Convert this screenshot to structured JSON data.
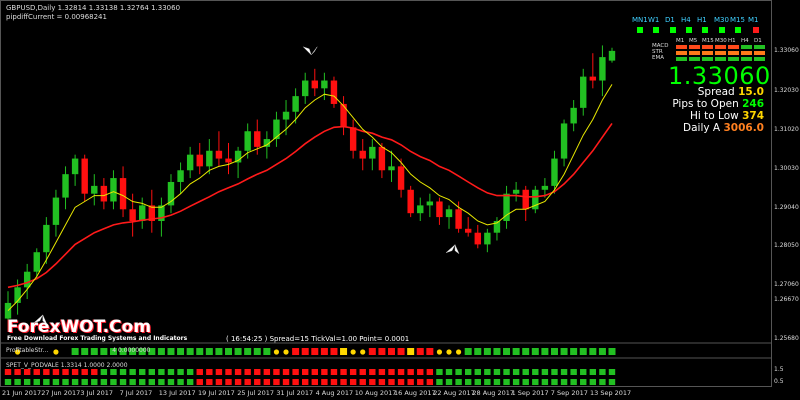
{
  "header": {
    "symbol_line": "GBPUSD,Daily   1.32814 1.33138 1.32764 1.33060",
    "pip_line": "pipdiffCurrent = 0.00968241"
  },
  "price_panel": {
    "price": "1.33060",
    "spread_label": "Spread",
    "spread_value": "15.0",
    "pips_open_label": "Pips to Open",
    "pips_open_value": "246",
    "hi_low_label": "Hi to Low",
    "hi_low_value": "374",
    "daily_label": "Daily A",
    "daily_value": "3006.0"
  },
  "timeframes": [
    "MN1",
    "W1",
    "D1",
    "H4",
    "H1",
    "M30",
    "M15",
    "M1"
  ],
  "matrix": {
    "cols": [
      "M1",
      "M5",
      "M15",
      "M30",
      "H1",
      "H4",
      "D1"
    ],
    "rows": [
      "MACD",
      "STR",
      "EMA"
    ]
  },
  "watermark": {
    "logo": "ForexWOT.Com",
    "tagline": "Free Download Forex Trading Systems and Indicators"
  },
  "info_line": "( 16:54:25 )  Spread=15  TickVal=1.00  Point= 0.0001",
  "indicators": {
    "ind1": "ProfitableStr...",
    "ind1_values": "4 0.0000000",
    "ind2": "SPET_V_PODVALE 1.3314 1.0000 2.0000"
  },
  "y_axis": [
    "1.33060",
    "1.32030",
    "1.31020",
    "1.30030",
    "1.29040",
    "1.28050",
    "1.27060",
    "1.26670",
    "1.25680",
    "1.25670"
  ],
  "y_axis_labels": [
    "1.33060",
    "1.32030",
    "1.31020",
    "1.30030",
    "1.29040",
    "1.28050",
    "1.27060",
    "1.26670",
    "1.25680"
  ],
  "y_axis_sub": [
    "1.5",
    "0.5"
  ],
  "x_axis": [
    "21 Jun 2017",
    "27 Jun 2017",
    "3 Jul 2017",
    "7 Jul 2017",
    "13 Jul 2017",
    "19 Jul 2017",
    "25 Jul 2017",
    "31 Jul 2017",
    "4 Aug 2017",
    "10 Aug 2017",
    "16 Aug 2017",
    "22 Aug 2017",
    "28 Aug 2017",
    "1 Sep 2017",
    "7 Sep 2017",
    "13 Sep 2017"
  ],
  "colors": {
    "bull": "#22c022",
    "bear": "#ff1010",
    "ema_fast": "#e8e800",
    "ema_slow": "#ff1a1a",
    "tf_dot": "#00ff00",
    "tf_dot_red": "#ff1a1a"
  },
  "chart_data": {
    "type": "candlestick",
    "series": [
      {
        "name": "GBPUSD",
        "candles": [
          [
            1.262,
            1.269,
            1.259,
            1.266
          ],
          [
            1.266,
            1.272,
            1.263,
            1.27
          ],
          [
            1.27,
            1.276,
            1.267,
            1.274
          ],
          [
            1.274,
            1.28,
            1.272,
            1.279
          ],
          [
            1.279,
            1.288,
            1.276,
            1.286
          ],
          [
            1.286,
            1.295,
            1.283,
            1.293
          ],
          [
            1.293,
            1.301,
            1.29,
            1.299
          ],
          [
            1.299,
            1.304,
            1.296,
            1.303
          ],
          [
            1.303,
            1.304,
            1.292,
            1.294
          ],
          [
            1.294,
            1.299,
            1.291,
            1.296
          ],
          [
            1.296,
            1.298,
            1.29,
            1.292
          ],
          [
            1.292,
            1.3,
            1.29,
            1.298
          ],
          [
            1.298,
            1.301,
            1.288,
            1.29
          ],
          [
            1.29,
            1.294,
            1.283,
            1.287
          ],
          [
            1.287,
            1.293,
            1.285,
            1.291
          ],
          [
            1.291,
            1.295,
            1.284,
            1.287
          ],
          [
            1.287,
            1.293,
            1.283,
            1.291
          ],
          [
            1.291,
            1.299,
            1.289,
            1.297
          ],
          [
            1.297,
            1.302,
            1.294,
            1.3
          ],
          [
            1.3,
            1.306,
            1.298,
            1.304
          ],
          [
            1.304,
            1.307,
            1.299,
            1.301
          ],
          [
            1.301,
            1.308,
            1.299,
            1.305
          ],
          [
            1.305,
            1.31,
            1.301,
            1.303
          ],
          [
            1.303,
            1.307,
            1.299,
            1.302
          ],
          [
            1.302,
            1.306,
            1.298,
            1.305
          ],
          [
            1.305,
            1.312,
            1.303,
            1.31
          ],
          [
            1.31,
            1.313,
            1.304,
            1.306
          ],
          [
            1.306,
            1.31,
            1.303,
            1.308
          ],
          [
            1.308,
            1.315,
            1.306,
            1.313
          ],
          [
            1.313,
            1.318,
            1.309,
            1.315
          ],
          [
            1.315,
            1.321,
            1.312,
            1.319
          ],
          [
            1.319,
            1.325,
            1.317,
            1.323
          ],
          [
            1.323,
            1.326,
            1.319,
            1.321
          ],
          [
            1.321,
            1.325,
            1.318,
            1.323
          ],
          [
            1.323,
            1.324,
            1.316,
            1.317
          ],
          [
            1.317,
            1.319,
            1.309,
            1.311
          ],
          [
            1.311,
            1.313,
            1.303,
            1.305
          ],
          [
            1.305,
            1.308,
            1.3,
            1.303
          ],
          [
            1.303,
            1.308,
            1.3,
            1.306
          ],
          [
            1.306,
            1.307,
            1.298,
            1.3
          ],
          [
            1.3,
            1.305,
            1.297,
            1.301
          ],
          [
            1.301,
            1.303,
            1.293,
            1.295
          ],
          [
            1.295,
            1.296,
            1.288,
            1.289
          ],
          [
            1.289,
            1.293,
            1.287,
            1.291
          ],
          [
            1.291,
            1.294,
            1.288,
            1.292
          ],
          [
            1.292,
            1.293,
            1.286,
            1.288
          ],
          [
            1.288,
            1.291,
            1.285,
            1.29
          ],
          [
            1.29,
            1.292,
            1.284,
            1.285
          ],
          [
            1.285,
            1.288,
            1.283,
            1.284
          ],
          [
            1.284,
            1.286,
            1.28,
            1.281
          ],
          [
            1.281,
            1.285,
            1.279,
            1.284
          ],
          [
            1.284,
            1.288,
            1.282,
            1.287
          ],
          [
            1.287,
            1.296,
            1.285,
            1.294
          ],
          [
            1.294,
            1.297,
            1.292,
            1.295
          ],
          [
            1.295,
            1.296,
            1.287,
            1.29
          ],
          [
            1.29,
            1.296,
            1.289,
            1.295
          ],
          [
            1.295,
            1.298,
            1.293,
            1.296
          ],
          [
            1.296,
            1.305,
            1.294,
            1.303
          ],
          [
            1.303,
            1.313,
            1.301,
            1.312
          ],
          [
            1.312,
            1.318,
            1.31,
            1.316
          ],
          [
            1.316,
            1.326,
            1.314,
            1.324
          ],
          [
            1.324,
            1.33,
            1.321,
            1.323
          ],
          [
            1.323,
            1.332,
            1.319,
            1.329
          ],
          [
            1.3281,
            1.3314,
            1.3276,
            1.3306
          ]
        ]
      },
      {
        "name": "EMA fast",
        "values": [
          1.264,
          1.2665,
          1.2695,
          1.2728,
          1.277,
          1.2815,
          1.286,
          1.2905,
          1.292,
          1.2935,
          1.2935,
          1.2945,
          1.2935,
          1.292,
          1.2915,
          1.2905,
          1.2905,
          1.292,
          1.294,
          1.2965,
          1.298,
          1.3,
          1.301,
          1.3015,
          1.3025,
          1.3045,
          1.3055,
          1.3065,
          1.3085,
          1.3105,
          1.313,
          1.316,
          1.318,
          1.3195,
          1.319,
          1.3165,
          1.3135,
          1.3105,
          1.3085,
          1.306,
          1.3045,
          1.302,
          1.299,
          1.297,
          1.2955,
          1.2935,
          1.2925,
          1.2905,
          1.289,
          1.287,
          1.286,
          1.2865,
          1.2885,
          1.29,
          1.29,
          1.291,
          1.292,
          1.295,
          1.299,
          1.304,
          1.309,
          1.313,
          1.318,
          1.322
        ]
      },
      {
        "name": "EMA slow",
        "values": [
          1.27,
          1.2705,
          1.2712,
          1.2722,
          1.2738,
          1.276,
          1.2785,
          1.281,
          1.2825,
          1.284,
          1.285,
          1.286,
          1.2865,
          1.2868,
          1.2872,
          1.2875,
          1.2878,
          1.2885,
          1.2895,
          1.2908,
          1.292,
          1.2932,
          1.2945,
          1.2955,
          1.2965,
          1.2978,
          1.299,
          1.3,
          1.3015,
          1.303,
          1.3048,
          1.3068,
          1.3085,
          1.31,
          1.311,
          1.3112,
          1.3108,
          1.31,
          1.3095,
          1.3085,
          1.3078,
          1.3065,
          1.3048,
          1.3035,
          1.3025,
          1.301,
          1.3,
          1.2985,
          1.297,
          1.2955,
          1.2942,
          1.2935,
          1.2935,
          1.2935,
          1.2932,
          1.2932,
          1.2935,
          1.2945,
          1.2965,
          1.299,
          1.302,
          1.305,
          1.3085,
          1.312
        ]
      }
    ],
    "ylim": [
      1.2565,
      1.338
    ],
    "title": "GBPUSD,Daily"
  }
}
